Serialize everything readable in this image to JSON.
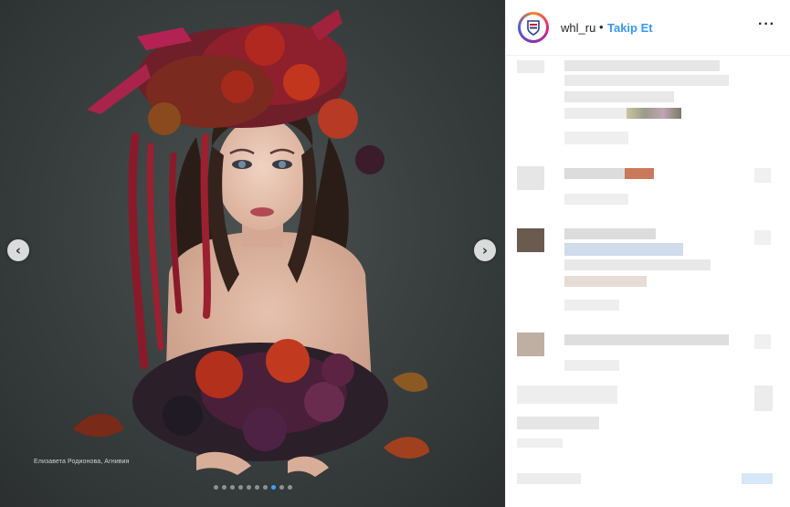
{
  "post": {
    "image_credit": "Елизавета Родионова, Агнивия",
    "carousel": {
      "count": 10,
      "active_index": 7
    }
  },
  "header": {
    "username": "whl_ru",
    "separator": "•",
    "follow_label": "Takip Et",
    "more_label": "···"
  },
  "colors": {
    "follow_blue": "#3897f0",
    "avatar_ring": [
      "#f58529",
      "#dd2a7b",
      "#8134af",
      "#515bd4"
    ],
    "text": "#262626",
    "divider": "#efefef"
  },
  "icons": {
    "prev": "chevron-left-icon",
    "next": "chevron-right-icon",
    "more": "more-options-icon"
  }
}
